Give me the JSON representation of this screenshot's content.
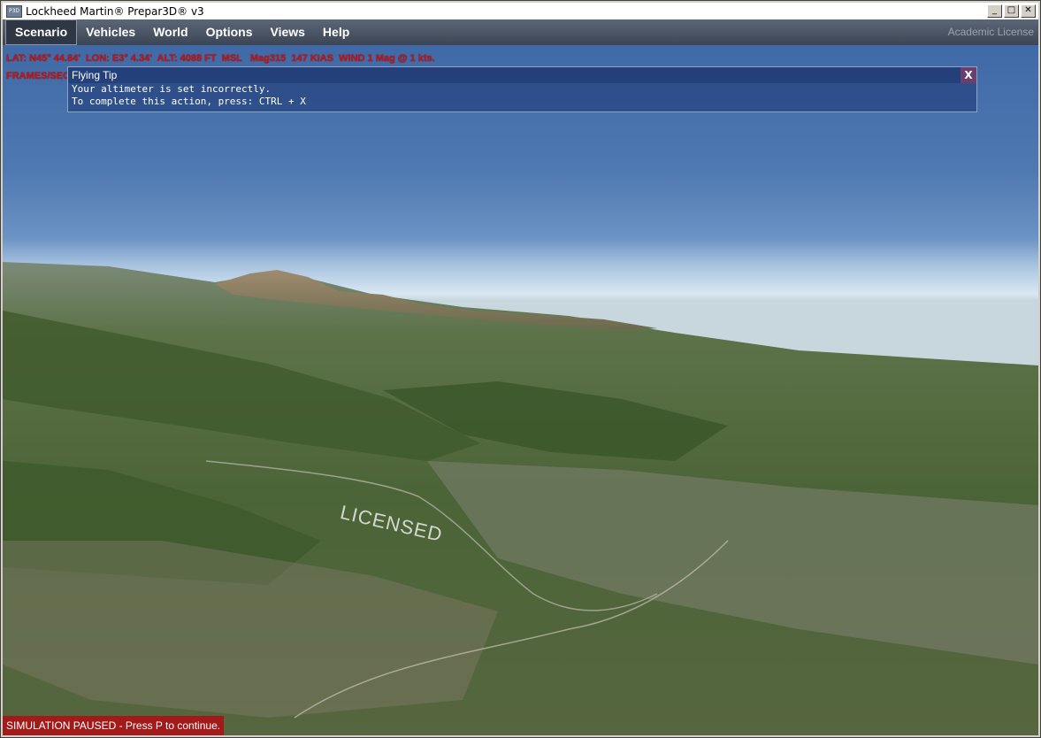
{
  "window": {
    "title": "Lockheed Martin® Prepar3D® v3",
    "app_icon_text": "P3D",
    "minimize": "_",
    "maximize": "□",
    "close": "✕"
  },
  "menu": {
    "items": [
      "Scenario",
      "Vehicles",
      "World",
      "Options",
      "Views",
      "Help"
    ],
    "license": "Academic License"
  },
  "hud": {
    "line1": "LAT: N45° 44.84'  LON: E3° 4.34'  ALT: 4088 FT  MSL   Mag315  147 KIAS  WIND 1 Mag @ 1 kts.",
    "line2": "FRAMES/SEC 30.1 (TARGET OF 40FPS)   +0.1 Gs   FUEL 51 %"
  },
  "tip": {
    "title": "Flying Tip",
    "close": "X",
    "line1": "Your altimeter is set incorrectly.",
    "line2": "To complete this action, press: CTRL + X"
  },
  "scene": {
    "watermark": "LICENSED",
    "sky_top": "#3f6aa7",
    "horizon": "#d9e7f3",
    "terrain": "#4f6a3b"
  },
  "footer": {
    "paused": "SIMULATION PAUSED - Press P to continue."
  }
}
